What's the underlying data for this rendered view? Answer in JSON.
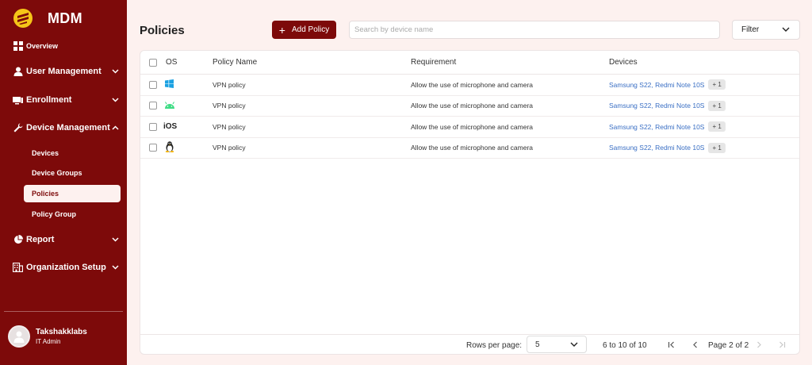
{
  "app": {
    "brand": "MDM"
  },
  "sidebar": {
    "items": [
      {
        "label": "Overview",
        "icon": "grid-icon"
      },
      {
        "label": "User Management",
        "icon": "user-icon"
      },
      {
        "label": "Enrollment",
        "icon": "monitor-icon"
      },
      {
        "label": "Device Management",
        "icon": "wrench-icon"
      },
      {
        "label": "Report",
        "icon": "pie-chart-icon"
      },
      {
        "label": "Organization Setup",
        "icon": "building-icon"
      }
    ],
    "sub_items": [
      {
        "label": "Devices"
      },
      {
        "label": "Device Groups"
      },
      {
        "label": "Policies",
        "active": true
      },
      {
        "label": "Policy Group"
      }
    ],
    "user": {
      "name": "Takshakklabs",
      "role": "IT Admin"
    }
  },
  "header": {
    "title": "Policies",
    "add_label": "Add Policy",
    "search_placeholder": "Search by device name",
    "filter_label": "Filter"
  },
  "table": {
    "columns": {
      "os": "OS",
      "name": "Policy Name",
      "requirement": "Requirement",
      "devices": "Devices"
    },
    "rows": [
      {
        "os": "windows",
        "name": "VPN policy",
        "requirement": "Allow the use of microphone and camera",
        "devices": "Samsung S22, Redmi Note 10S",
        "extra": "+ 1"
      },
      {
        "os": "android",
        "name": "VPN policy",
        "requirement": "Allow the use of microphone and camera",
        "devices": "Samsung S22, Redmi Note 10S",
        "extra": "+ 1"
      },
      {
        "os": "ios",
        "os_text": "iOS",
        "name": "VPN policy",
        "requirement": "Allow the use of microphone and camera",
        "devices": "Samsung S22, Redmi Note 10S",
        "extra": "+ 1"
      },
      {
        "os": "linux",
        "name": "VPN policy",
        "requirement": "Allow the use of microphone and camera",
        "devices": "Samsung S22, Redmi Note 10S",
        "extra": "+ 1"
      }
    ]
  },
  "pagination": {
    "rows_per_page_label": "Rows per page:",
    "rows_per_page": "5",
    "range": "6 to 10 of 10",
    "page": "Page 2 of 2"
  },
  "colors": {
    "primary": "#7d0a0a",
    "background": "#fdf1ef",
    "link": "#3a6fc4"
  }
}
